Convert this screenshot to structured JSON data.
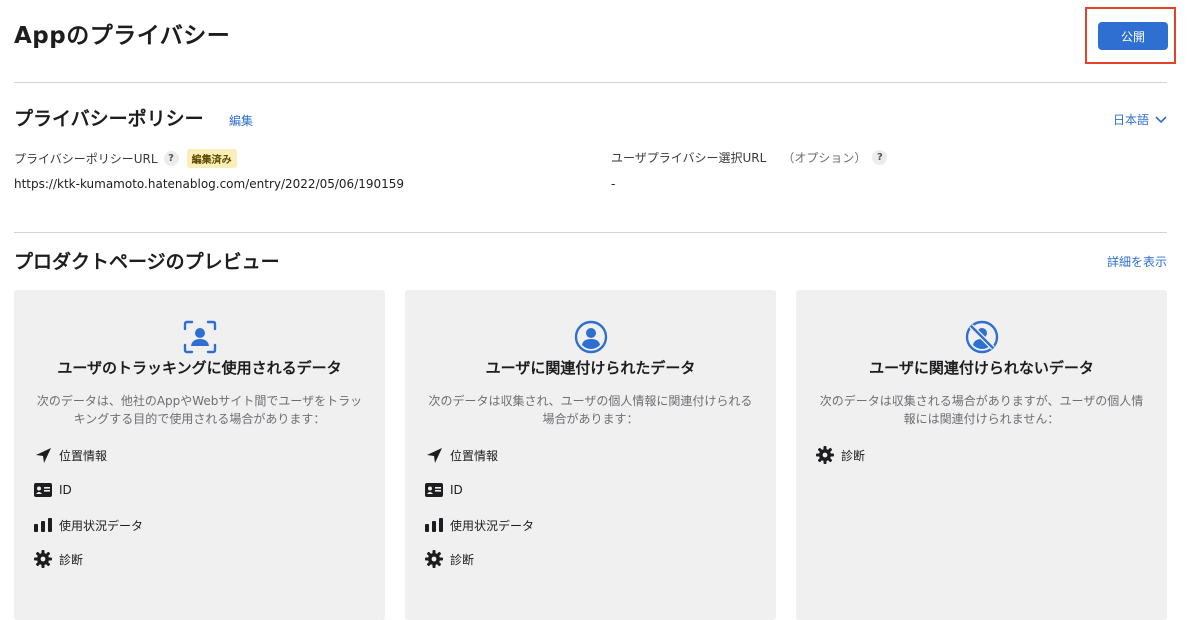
{
  "header": {
    "title": "Appのプライバシー",
    "publish_label": "公開"
  },
  "privacy_policy": {
    "title": "プライバシーポリシー",
    "edit_label": "編集",
    "language": "日本語",
    "policy_url_label": "プライバシーポリシーURL",
    "help_symbol": "?",
    "edited_badge": "編集済み",
    "policy_url_value": "https://ktk-kumamoto.hatenablog.com/entry/2022/05/06/190159",
    "choice_url_label": "ユーザプライバシー選択URL",
    "choice_url_optional": "（オプション）",
    "choice_url_value": "-"
  },
  "preview": {
    "title": "プロダクトページのプレビュー",
    "details_label": "詳細を表示",
    "cards": [
      {
        "icon": "user-tracking-icon",
        "title": "ユーザのトラッキングに使用されるデータ",
        "description": "次のデータは、他社のAppやWebサイト間でユーザをトラッキングする目的で使用される場合があります：",
        "items": [
          {
            "icon": "location-arrow-icon",
            "label": "位置情報"
          },
          {
            "icon": "id-card-icon",
            "label": "ID"
          },
          {
            "icon": "bar-chart-icon",
            "label": "使用状況データ"
          },
          {
            "icon": "gear-icon",
            "label": "診断"
          }
        ]
      },
      {
        "icon": "user-circle-icon",
        "title": "ユーザに関連付けられたデータ",
        "description": "次のデータは収集され、ユーザの個人情報に関連付けられる場合があります：",
        "items": [
          {
            "icon": "location-arrow-icon",
            "label": "位置情報"
          },
          {
            "icon": "id-card-icon",
            "label": "ID"
          },
          {
            "icon": "bar-chart-icon",
            "label": "使用状況データ"
          },
          {
            "icon": "gear-icon",
            "label": "診断"
          }
        ]
      },
      {
        "icon": "user-slash-icon",
        "title": "ユーザに関連付けられないデータ",
        "description": "次のデータは収集される場合がありますが、ユーザの個人情報には関連付けられません：",
        "items": [
          {
            "icon": "gear-icon",
            "label": "診断"
          }
        ]
      }
    ]
  },
  "colors": {
    "accent": "#2f6fd1",
    "highlight_border": "#e0442a",
    "card_bg": "#f0f0f0",
    "badge_bg": "#fbeeb8"
  }
}
